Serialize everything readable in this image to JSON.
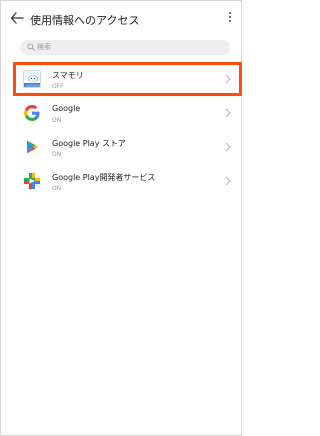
{
  "header": {
    "title": "使用情報へのアクセス",
    "back_icon": "arrow-left-icon",
    "more_icon": "more-vert-icon"
  },
  "search": {
    "placeholder": "検索",
    "icon": "search-icon"
  },
  "apps": [
    {
      "name": "スマモリ",
      "status": "OFF",
      "icon": "sumamori-app-icon"
    },
    {
      "name": "Google",
      "status": "ON",
      "icon": "google-g-icon"
    },
    {
      "name": "Google Play ストア",
      "status": "ON",
      "icon": "google-play-store-icon"
    },
    {
      "name": "Google Play開発者サービス",
      "status": "ON",
      "icon": "google-play-services-icon"
    }
  ],
  "colors": {
    "highlight": "#ff4a14",
    "google_blue": "#4285f4",
    "google_red": "#ea4335",
    "google_yellow": "#fbbc05",
    "google_green": "#34a853"
  }
}
